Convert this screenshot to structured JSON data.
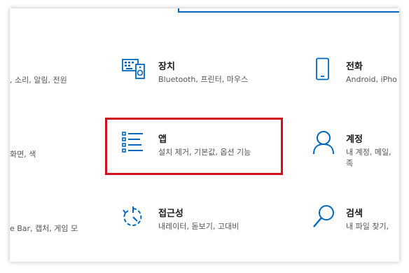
{
  "colors": {
    "accent": "#0067c0",
    "highlight": "#d0101a",
    "title": "#1a1a1a",
    "desc": "#555555"
  },
  "left_column": {
    "row1_desc": ", 소리, 알림, 전원",
    "row2_desc": "화면, 색",
    "row3_desc": "e Bar, 캡처, 게임 모"
  },
  "tiles": {
    "devices": {
      "title": "장치",
      "desc": "Bluetooth, 프린터, 마우스",
      "icon": "keyboard-speaker-icon"
    },
    "phone": {
      "title": "전화",
      "desc": "Android, iPho",
      "icon": "phone-icon"
    },
    "apps": {
      "title": "앱",
      "desc": "설치 제거, 기본값, 옵션 기능",
      "icon": "apps-list-icon"
    },
    "accounts": {
      "title": "계정",
      "desc_line1": "내 계정, 메일, ",
      "desc_line2": "족",
      "icon": "person-icon"
    },
    "accessibility": {
      "title": "접근성",
      "desc": "내레이터, 돋보기, 고대비",
      "icon": "accessibility-timer-icon"
    },
    "search": {
      "title": "검색",
      "desc": "내 파일 찾기, ",
      "icon": "magnifier-icon"
    }
  }
}
